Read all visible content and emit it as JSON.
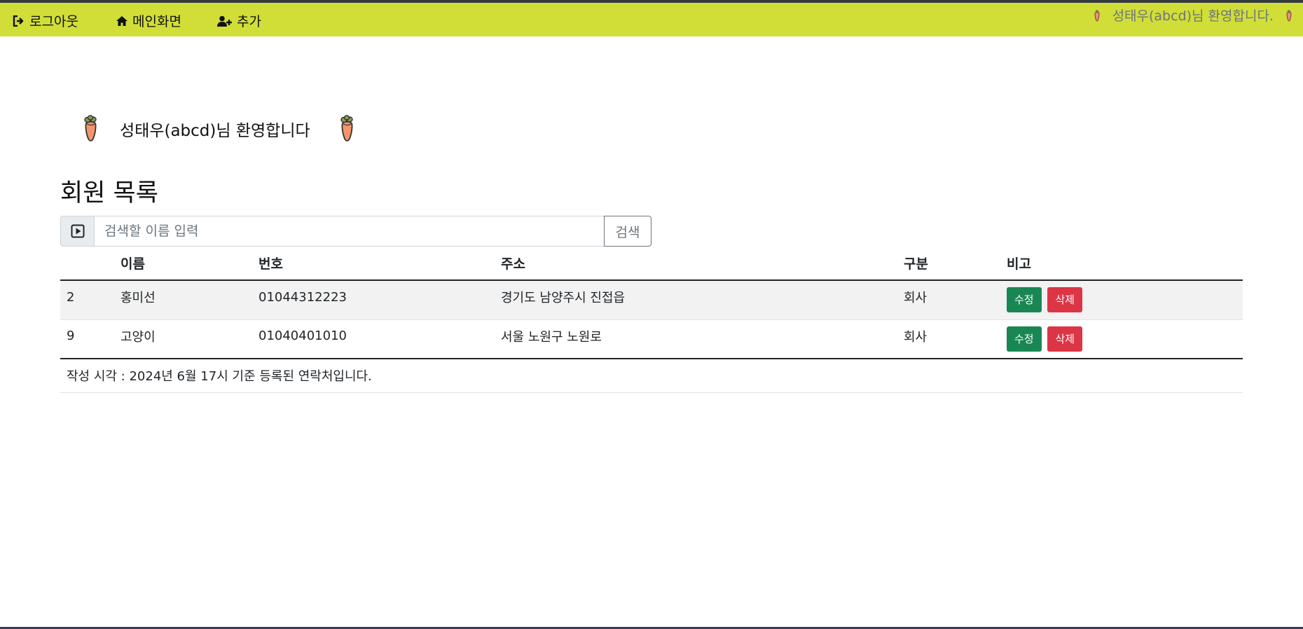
{
  "navbar": {
    "logout_label": "로그아웃",
    "home_label": "메인화면",
    "add_label": "추가",
    "welcome_text": "성태우(abcd)님 환영합니다."
  },
  "welcome": {
    "text": "성태우(abcd)님 환영합니다"
  },
  "page": {
    "title": "회원 목록"
  },
  "search": {
    "placeholder": "검색할 이름 입력",
    "button_label": "검색"
  },
  "table": {
    "columns": [
      "",
      "이름",
      "번호",
      "주소",
      "구분",
      "비고"
    ],
    "rows": [
      {
        "id": "2",
        "name": "홍미선",
        "phone": "01044312223",
        "address": "경기도 남양주시 진접읍",
        "type": "회사",
        "edit": "수정",
        "delete": "삭제"
      },
      {
        "id": "9",
        "name": "고양이",
        "phone": "01040401010",
        "address": "서울 노원구 노원로",
        "type": "회사",
        "edit": "수정",
        "delete": "삭제"
      }
    ],
    "footer": "작성 시각 : 2024년 6월 17시 기준 등록된 연락처입니다."
  },
  "colors": {
    "navbar_bg": "#d1de37",
    "edit_button": "#198754",
    "delete_button": "#dc3545"
  },
  "icons": [
    "sign-out-icon",
    "home-icon",
    "user-plus-icon",
    "carrot-icon",
    "play-square-icon"
  ]
}
